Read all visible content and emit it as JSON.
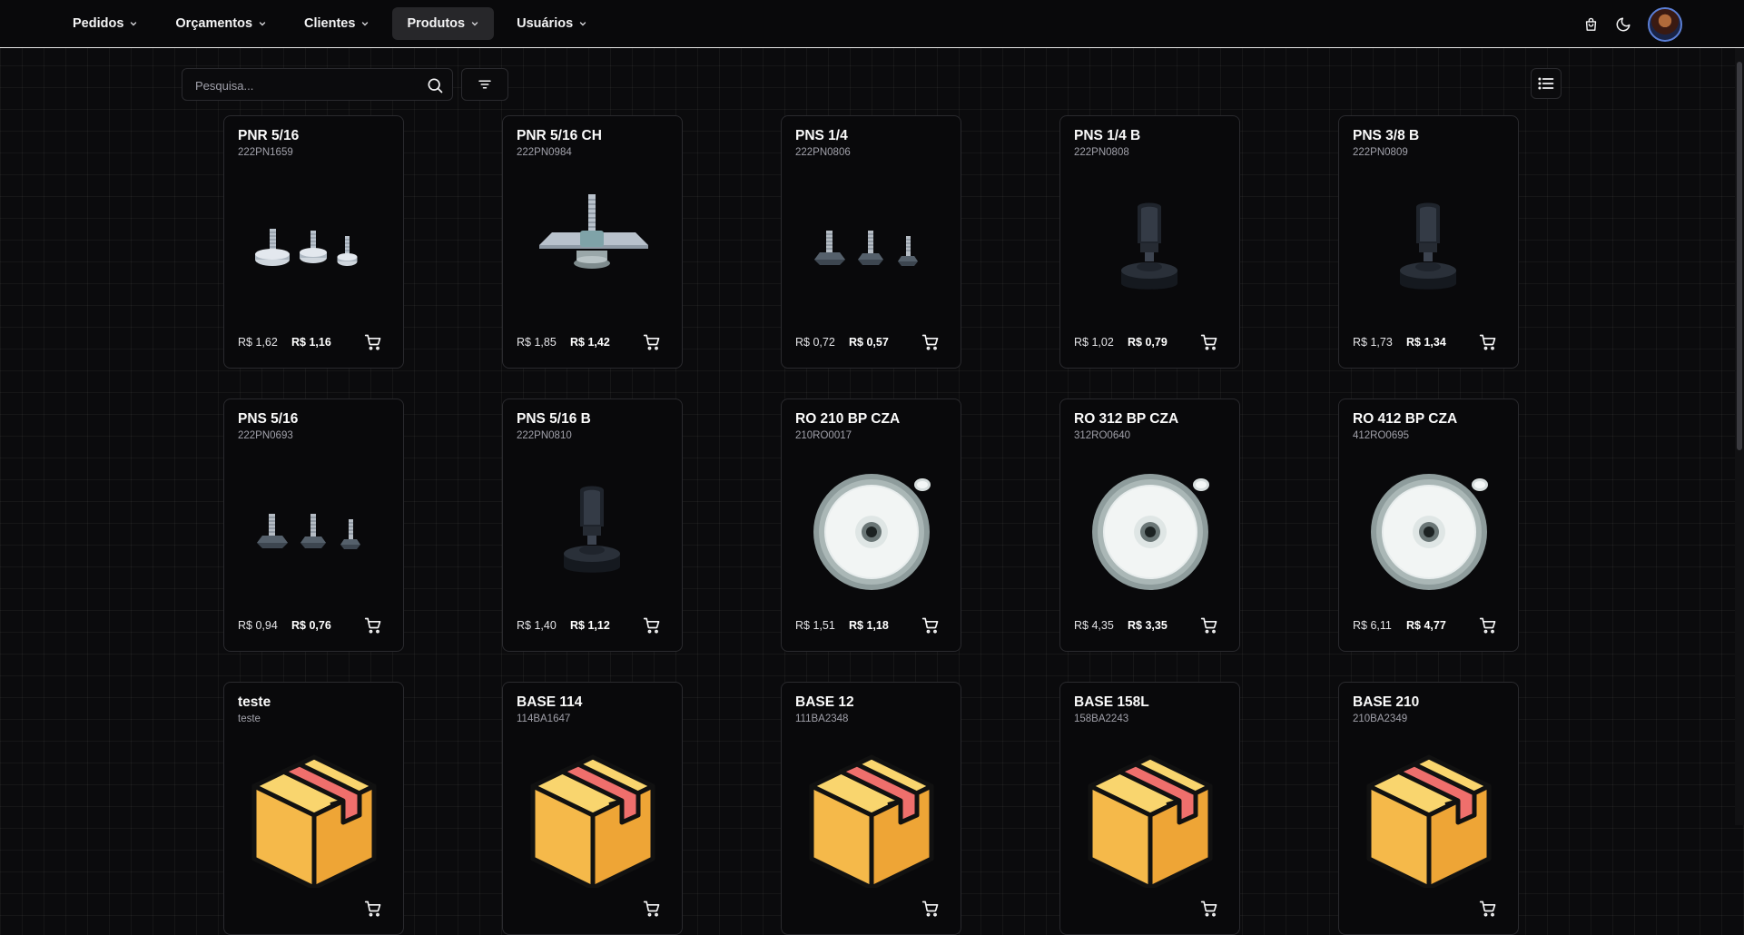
{
  "nav": {
    "items": [
      {
        "label": "Pedidos",
        "active": false
      },
      {
        "label": "Orçamentos",
        "active": false
      },
      {
        "label": "Clientes",
        "active": false
      },
      {
        "label": "Produtos",
        "active": true
      },
      {
        "label": "Usuários",
        "active": false
      }
    ]
  },
  "top_icons": [
    "shopping-bag-icon",
    "moon-icon",
    "avatar"
  ],
  "search": {
    "placeholder": "Pesquisa...",
    "value": ""
  },
  "colors": {
    "background": "#0b0b0d",
    "card": "#09090b",
    "border": "#2a2a2e",
    "active_nav": "#27272a"
  },
  "products": [
    {
      "name": "PNR 5/16",
      "code": "222PN1659",
      "price_old": "R$ 1,62",
      "price_new": "R$ 1,16",
      "image": "three-leveling-feet"
    },
    {
      "name": "PNR 5/16 CH",
      "code": "222PN0984",
      "price_old": "R$ 1,85",
      "price_new": "R$ 1,42",
      "image": "plate-leveling-foot"
    },
    {
      "name": "PNS 1/4",
      "code": "222PN0806",
      "price_old": "R$ 0,72",
      "price_new": "R$ 0,57",
      "image": "three-leveling-feet-dark"
    },
    {
      "name": "PNS 1/4 B",
      "code": "222PN0808",
      "price_old": "R$ 1,02",
      "price_new": "R$ 0,79",
      "image": "socket-leveling-foot"
    },
    {
      "name": "PNS 3/8 B",
      "code": "222PN0809",
      "price_old": "R$ 1,73",
      "price_new": "R$ 1,34",
      "image": "socket-leveling-foot"
    },
    {
      "name": "PNS 5/16",
      "code": "222PN0693",
      "price_old": "R$ 0,94",
      "price_new": "R$ 0,76",
      "image": "three-leveling-feet-dark"
    },
    {
      "name": "PNS 5/16 B",
      "code": "222PN0810",
      "price_old": "R$ 1,40",
      "price_new": "R$ 1,12",
      "image": "socket-leveling-foot"
    },
    {
      "name": "RO 210 BP CZA",
      "code": "210RO0017",
      "price_old": "R$ 1,51",
      "price_new": "R$ 1,18",
      "image": "gray-wheel"
    },
    {
      "name": "RO 312 BP CZA",
      "code": "312RO0640",
      "price_old": "R$ 4,35",
      "price_new": "R$ 3,35",
      "image": "gray-wheel"
    },
    {
      "name": "RO 412 BP CZA",
      "code": "412RO0695",
      "price_old": "R$ 6,11",
      "price_new": "R$ 4,77",
      "image": "gray-wheel"
    },
    {
      "name": "teste",
      "code": "teste",
      "price_old": "",
      "price_new": "",
      "image": "box-placeholder"
    },
    {
      "name": "BASE 114",
      "code": "114BA1647",
      "price_old": "",
      "price_new": "",
      "image": "box-placeholder"
    },
    {
      "name": "BASE 12",
      "code": "111BA2348",
      "price_old": "",
      "price_new": "",
      "image": "box-placeholder"
    },
    {
      "name": "BASE 158L",
      "code": "158BA2243",
      "price_old": "",
      "price_new": "",
      "image": "box-placeholder"
    },
    {
      "name": "BASE 210",
      "code": "210BA2349",
      "price_old": "",
      "price_new": "",
      "image": "box-placeholder"
    }
  ]
}
